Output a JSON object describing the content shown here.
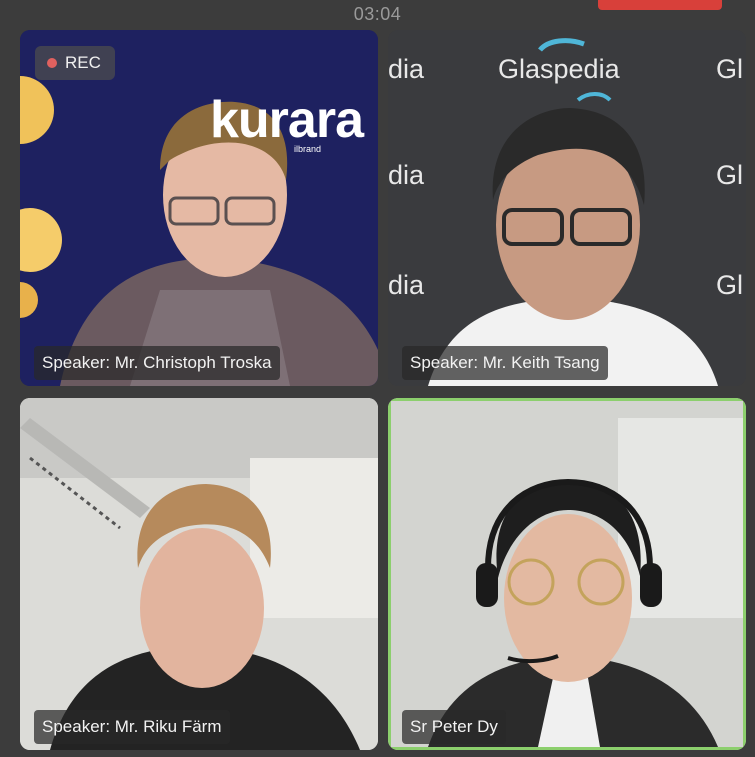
{
  "timer": "03:04",
  "recording": {
    "label": "REC",
    "dot_color": "#e0615f"
  },
  "tiles": [
    {
      "name": "Speaker: Mr. Christoph Troska",
      "backdrop_text": "kurara",
      "backdrop_sub": "ilbrand"
    },
    {
      "name": "Speaker: Mr. Keith Tsang",
      "backdrop_text": "Glaspedia",
      "backdrop_fragment_left": "dia",
      "backdrop_fragment_right": "Gl"
    },
    {
      "name": "Speaker: Mr. Riku Färm"
    },
    {
      "name": "Sr Peter Dy",
      "active": true,
      "active_border_color": "#8ccf6d"
    }
  ]
}
